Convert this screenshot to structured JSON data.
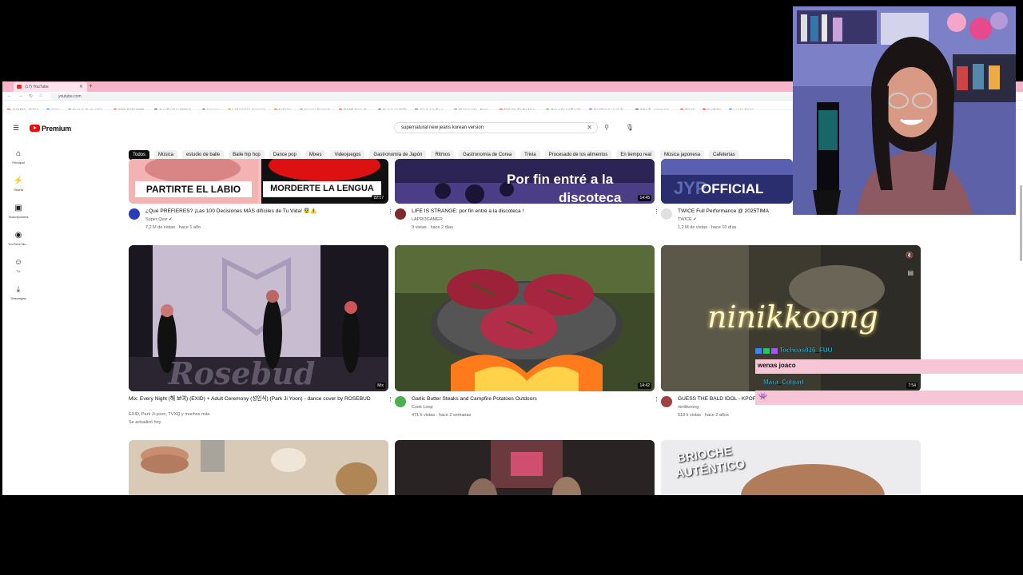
{
  "browser": {
    "tab_title": "(17) YouTube",
    "url": "youtube.com",
    "bookmarks": [
      {
        "label": "ANIMES - Todos",
        "color": "#c33"
      },
      {
        "label": "Inicio",
        "color": "#1a73e8"
      },
      {
        "label": "Cursos de Investig...",
        "color": "#888"
      },
      {
        "label": "2026 ESNVERT...",
        "color": "#e53935"
      },
      {
        "label": "Sureño Stor 2022 S...",
        "color": "#333"
      },
      {
        "label": "pag nov",
        "color": "#555"
      },
      {
        "label": "Laboratorio Serencia",
        "color": "#7cb342"
      },
      {
        "label": "Noticias",
        "color": "#f4511e"
      },
      {
        "label": "Nuevas lineas le",
        "color": "#888"
      },
      {
        "label": "(5570) Foro de...",
        "color": "#e53935"
      },
      {
        "label": "Nueva pestaña",
        "color": "#555"
      },
      {
        "label": "Sin 5 por dio e...",
        "color": "#555"
      },
      {
        "label": "El proyecto - Persi...",
        "color": "#777"
      },
      {
        "label": "(26) Studio De Mus...",
        "color": "#e53935"
      },
      {
        "label": "Proyecto Unificado",
        "color": "#43a047"
      },
      {
        "label": "Cambiar tu cuel de...",
        "color": "#8e24aa"
      },
      {
        "label": "GitHub - wrappers...",
        "color": "#222"
      },
      {
        "label": "Gmail",
        "color": "#d93025"
      },
      {
        "label": "YouTube",
        "color": "#ff0000"
      },
      {
        "label": "Lucca Fisica",
        "color": "#1a73e8"
      }
    ]
  },
  "header": {
    "logo_word": "Premium",
    "search_value": "supernatural new jeans korean version"
  },
  "chips": [
    "Todos",
    "Música",
    "estudio de baile",
    "Baile hip hop",
    "Dance pop",
    "Mixes",
    "Videojuegos",
    "Gastronomía de Japón",
    "Ritmos",
    "Gastronomía de Corea",
    "Trivia",
    "Procesado de los alimentos",
    "En tiempo real",
    "Música japonesa",
    "Cafeterías"
  ],
  "sidebar": [
    {
      "icon": "home-icon",
      "label": "Principal"
    },
    {
      "icon": "shorts-icon",
      "label": "Shorts"
    },
    {
      "icon": "subscriptions-icon",
      "label": "Suscripciones"
    },
    {
      "icon": "music-icon",
      "label": "YouTube Mu..."
    },
    {
      "icon": "you-icon",
      "label": "Tú"
    },
    {
      "icon": "download-icon",
      "label": "Descargas"
    }
  ],
  "row1": [
    {
      "thumb_text_a": "PARTIRTE EL LABIO",
      "thumb_text_b": "MORDERTE LA LENGUA",
      "duration": "22:17",
      "title": "¿Qué PREFIERES? ¡Las 100 Decisiones MÁS difíciles de Tu Vida! 😨⚠️",
      "channel": "Super Quiz ✔",
      "stats": "7,2 M de vistas · hace 1 año",
      "avatar_color": "#2a3db8"
    },
    {
      "thumb_text_a": "Por fin entré a la",
      "thumb_text_b": "discoteca",
      "duration": "14:45",
      "title": "LIFE IS STRANGE: por fin entré a la discoteca !",
      "channel": "LAPROGAMER",
      "stats": "9 vistas · hace 2 días",
      "avatar_color": "#7b2d2d"
    },
    {
      "thumb_text_a": "OFFICIAL",
      "duration": "",
      "title": "TWICE Full Performance @ 2025TIMA",
      "channel": "TWICE ✔",
      "stats": "1,2 M de vistas · hace 10 días",
      "avatar_color": "#e0e0e0"
    }
  ],
  "row2": [
    {
      "thumb_text_a": "Rosebud",
      "badge": "Mix",
      "title": "Mix: Every Night (해 보여) (EXID) + Adult Ceremony (성인식) (Park Ji Yoon) - dance cover by ROSEBUD",
      "channel": "EXID, Park Ji-yoon, TVXQ y muchos más",
      "stats": "Se actualizó hoy",
      "avatar_color": ""
    },
    {
      "duration": "14:42",
      "title": "Garlic Butter Steaks and Campfire Potatoes Outdoors",
      "channel": "Cook Loop",
      "stats": "471 k vistas · hace 2 semanas",
      "avatar_color": "#4caf50"
    },
    {
      "thumb_text_a": "ninikkoong",
      "duration": "7:54",
      "title": "GUESS THE BALD IDOL - KPOP",
      "channel": "ninikkoong",
      "stats": "518 k vistas · hace 2 años",
      "avatar_color": "#a04040"
    }
  ],
  "row3": [
    {
      "thumb_text_a": ""
    },
    {
      "thumb_text_a": ""
    },
    {
      "thumb_text_a": "BRIOCHE",
      "thumb_text_b": "AUTÉNTICO"
    }
  ],
  "chat": {
    "user1": "Tochoas016_FUU",
    "msg1": "wenas joaco",
    "user2": "Mara_Colpad"
  },
  "colors": {
    "tabbar": "#f6b4c8",
    "chat_bg": "#f7c6d6",
    "chip_active": "#0f0f0f",
    "yt_red": "#ff0000"
  }
}
